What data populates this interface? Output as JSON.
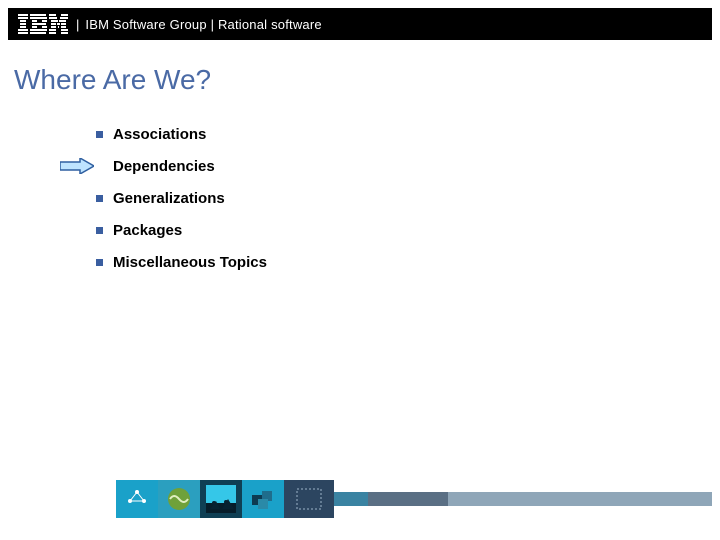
{
  "header": {
    "text": "IBM Software Group | Rational software"
  },
  "title": "Where Are We?",
  "items": [
    {
      "label": "Associations",
      "current": false
    },
    {
      "label": "Dependencies",
      "current": true
    },
    {
      "label": "Generalizations",
      "current": false
    },
    {
      "label": "Packages",
      "current": false
    },
    {
      "label": "Miscellaneous Topics",
      "current": false
    }
  ]
}
